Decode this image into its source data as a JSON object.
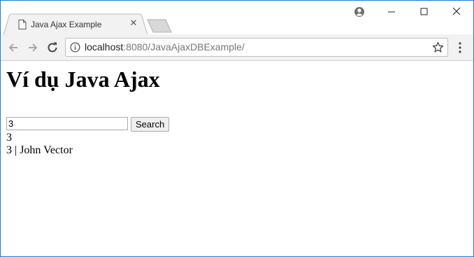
{
  "browser": {
    "tab_title": "Java Ajax Example",
    "url_host": "localhost",
    "url_rest": ":8080/JavaAjaxDBExample/"
  },
  "page": {
    "heading": "Ví dụ Java Ajax",
    "search_value": "3",
    "search_button": "Search",
    "echo_value": "3",
    "result": "3 | John Vector"
  },
  "icons": {
    "tab": "page-icon",
    "close": "close-icon",
    "profile": "profile-icon",
    "back": "back-arrow-icon",
    "forward": "forward-arrow-icon",
    "reload": "reload-icon",
    "info": "info-icon",
    "bookmark": "star-icon",
    "menu": "menu-dots-icon"
  },
  "colors": {
    "window_border": "#1e7ccf",
    "toolbar": "#f2f2f2"
  }
}
